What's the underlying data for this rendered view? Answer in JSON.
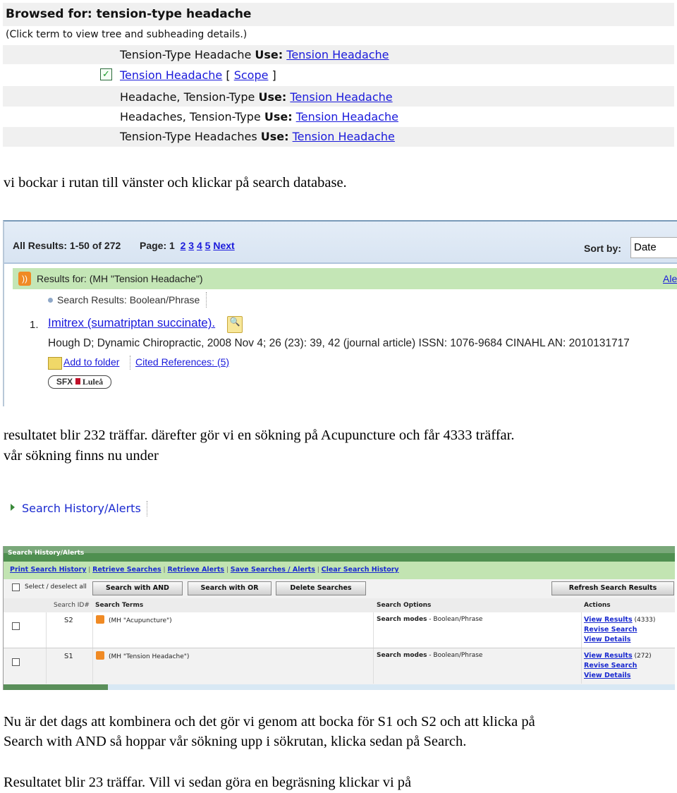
{
  "browse": {
    "title": "Browsed for: tension-type headache",
    "hint": "(Click term to view tree and subheading details.)",
    "rows": [
      {
        "term": "Tension-Type Headache",
        "use": "Use:",
        "link": "Tension Headache"
      },
      {
        "term": "Tension Headache",
        "scope_open": "[",
        "scope": "Scope",
        "scope_close": "]",
        "checked": true
      },
      {
        "term": "Headache, Tension-Type",
        "use": "Use:",
        "link": "Tension Headache"
      },
      {
        "term": "Headaches, Tension-Type",
        "use": "Use:",
        "link": "Tension Headache"
      },
      {
        "term": "Tension-Type Headaches",
        "use": "Use:",
        "link": "Tension Headache"
      }
    ]
  },
  "para1": "vi bockar i rutan till vänster och klickar på search database.",
  "results": {
    "all_results": "All Results: 1-50 of 272",
    "page_label": "Page: 1",
    "pages": [
      "2",
      "3",
      "4",
      "5"
    ],
    "next": "Next",
    "sort_label": "Sort by:",
    "sort_value": "Date",
    "results_for": "Results for: (MH \"Tension Headache\")",
    "alert_link": "Ale",
    "mode": "Search Results: Boolean/Phrase",
    "item": {
      "num": "1.",
      "title": "Imitrex (sumatriptan succinate).",
      "details": "Hough D; Dynamic Chiropractic, 2008 Nov 4; 26 (23): 39, 42 (journal article) ISSN: 1076-9684 CINAHL AN: 2010131717",
      "add_folder": "Add to folder",
      "cited": "Cited References: (5)",
      "sfx": "SFX",
      "sfx_lib": "Luleå"
    }
  },
  "para2a": "resultatet blir 232 träffar. därefter gör vi en sökning på Acupuncture och får 4333 träffar.",
  "para2b": "vår sökning finns nu under",
  "history_link": "Search History/Alerts",
  "history": {
    "title": "Search History/Alerts",
    "links": [
      "Print Search History",
      "Retrieve Searches",
      "Retrieve Alerts",
      "Save Searches / Alerts",
      "Clear Search History"
    ],
    "select_all": "Select / deselect all",
    "buttons": [
      "Search with AND",
      "Search with OR",
      "Delete Searches",
      "Refresh Search Results"
    ],
    "columns": [
      "Search ID#",
      "Search Terms",
      "Search Options",
      "Actions"
    ],
    "rows": [
      {
        "id": "S2",
        "terms": "(MH \"Acupuncture\")",
        "mode_label": "Search modes",
        "mode": " - Boolean/Phrase",
        "view": "View Results",
        "count": "(4333)",
        "revise": "Revise Search",
        "details": "View Details"
      },
      {
        "id": "S1",
        "terms": "(MH \"Tension Headache\")",
        "mode_label": "Search modes",
        "mode": " - Boolean/Phrase",
        "view": "View Results",
        "count": "(272)",
        "revise": "Revise Search",
        "details": "View Details"
      }
    ]
  },
  "para3a": "Nu är det dags att kombinera och det gör vi genom att bocka för S1 och S2 och att klicka på",
  "para3b": "Search with AND så hoppar vår sökning upp i sökrutan, klicka sedan på Search.",
  "para4": "Resultatet blir 23 träffar. Vill vi sedan göra en begräsning klickar vi på"
}
